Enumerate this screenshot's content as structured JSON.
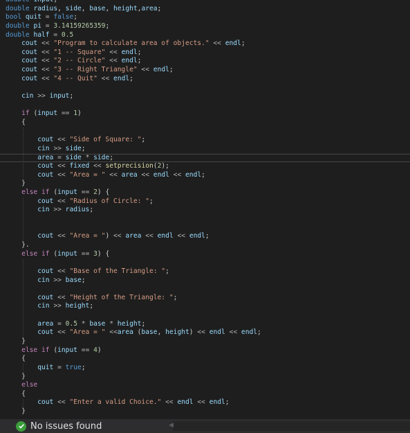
{
  "editor": {
    "lines": [
      [
        [
          "kw",
          "double"
        ],
        [
          "plain",
          " "
        ],
        [
          "id",
          "input"
        ],
        [
          "plain",
          ";"
        ]
      ],
      [
        [
          "kw",
          "double"
        ],
        [
          "plain",
          " "
        ],
        [
          "id",
          "radius"
        ],
        [
          "plain",
          ", "
        ],
        [
          "id",
          "side"
        ],
        [
          "plain",
          ", "
        ],
        [
          "id",
          "base"
        ],
        [
          "plain",
          ", "
        ],
        [
          "id",
          "height"
        ],
        [
          "plain",
          ","
        ],
        [
          "id",
          "area"
        ],
        [
          "plain",
          ";"
        ]
      ],
      [
        [
          "kw",
          "bool"
        ],
        [
          "plain",
          " "
        ],
        [
          "id",
          "quit"
        ],
        [
          "plain",
          " "
        ],
        [
          "op",
          "="
        ],
        [
          "plain",
          " "
        ],
        [
          "kw",
          "false"
        ],
        [
          "plain",
          ";"
        ]
      ],
      [
        [
          "kw",
          "double"
        ],
        [
          "plain",
          " "
        ],
        [
          "id",
          "pi"
        ],
        [
          "plain",
          " "
        ],
        [
          "op",
          "="
        ],
        [
          "plain",
          " "
        ],
        [
          "num",
          "3.14159265359"
        ],
        [
          "plain",
          ";"
        ]
      ],
      [
        [
          "kw",
          "double"
        ],
        [
          "plain",
          " "
        ],
        [
          "id",
          "half"
        ],
        [
          "plain",
          " "
        ],
        [
          "op",
          "="
        ],
        [
          "plain",
          " "
        ],
        [
          "num",
          "0.5"
        ]
      ],
      [
        [
          "plain",
          "    "
        ],
        [
          "id",
          "cout"
        ],
        [
          "plain",
          " "
        ],
        [
          "op",
          "<<"
        ],
        [
          "plain",
          " "
        ],
        [
          "str",
          "\"Program to calculate area of objects.\""
        ],
        [
          "plain",
          " "
        ],
        [
          "op",
          "<<"
        ],
        [
          "plain",
          " "
        ],
        [
          "id",
          "endl"
        ],
        [
          "plain",
          ";"
        ]
      ],
      [
        [
          "plain",
          "    "
        ],
        [
          "id",
          "cout"
        ],
        [
          "plain",
          " "
        ],
        [
          "op",
          "<<"
        ],
        [
          "plain",
          " "
        ],
        [
          "str",
          "\"1 -- Square\""
        ],
        [
          "plain",
          " "
        ],
        [
          "op",
          "<<"
        ],
        [
          "plain",
          " "
        ],
        [
          "id",
          "endl"
        ],
        [
          "plain",
          ";"
        ]
      ],
      [
        [
          "plain",
          "    "
        ],
        [
          "id",
          "cout"
        ],
        [
          "plain",
          " "
        ],
        [
          "op",
          "<<"
        ],
        [
          "plain",
          " "
        ],
        [
          "str",
          "\"2 -- Circle\""
        ],
        [
          "plain",
          " "
        ],
        [
          "op",
          "<<"
        ],
        [
          "plain",
          " "
        ],
        [
          "id",
          "endl"
        ],
        [
          "plain",
          ";"
        ]
      ],
      [
        [
          "plain",
          "    "
        ],
        [
          "id",
          "cout"
        ],
        [
          "plain",
          " "
        ],
        [
          "op",
          "<<"
        ],
        [
          "plain",
          " "
        ],
        [
          "str",
          "\"3 -- Right Triangle\""
        ],
        [
          "plain",
          " "
        ],
        [
          "op",
          "<<"
        ],
        [
          "plain",
          " "
        ],
        [
          "id",
          "endl"
        ],
        [
          "plain",
          ";"
        ]
      ],
      [
        [
          "plain",
          "    "
        ],
        [
          "id",
          "cout"
        ],
        [
          "plain",
          " "
        ],
        [
          "op",
          "<<"
        ],
        [
          "plain",
          " "
        ],
        [
          "str",
          "\"4 -- Quit\""
        ],
        [
          "plain",
          " "
        ],
        [
          "op",
          "<<"
        ],
        [
          "plain",
          " "
        ],
        [
          "id",
          "endl"
        ],
        [
          "plain",
          ";"
        ]
      ],
      [],
      [
        [
          "plain",
          "    "
        ],
        [
          "id",
          "cin"
        ],
        [
          "plain",
          " "
        ],
        [
          "op",
          ">>"
        ],
        [
          "plain",
          " "
        ],
        [
          "id",
          "input"
        ],
        [
          "plain",
          ";"
        ]
      ],
      [],
      [
        [
          "plain",
          "    "
        ],
        [
          "ctl",
          "if"
        ],
        [
          "plain",
          " ("
        ],
        [
          "id",
          "input"
        ],
        [
          "plain",
          " "
        ],
        [
          "op",
          "=="
        ],
        [
          "plain",
          " "
        ],
        [
          "num",
          "1"
        ],
        [
          "plain",
          ")"
        ]
      ],
      [
        [
          "plain",
          "    {"
        ]
      ],
      [],
      [
        [
          "plain",
          "        "
        ],
        [
          "id",
          "cout"
        ],
        [
          "plain",
          " "
        ],
        [
          "op",
          "<<"
        ],
        [
          "plain",
          " "
        ],
        [
          "str",
          "\"Side of Square: \""
        ],
        [
          "plain",
          ";"
        ]
      ],
      [
        [
          "plain",
          "        "
        ],
        [
          "id",
          "cin"
        ],
        [
          "plain",
          " "
        ],
        [
          "op",
          ">>"
        ],
        [
          "plain",
          " "
        ],
        [
          "id",
          "side"
        ],
        [
          "plain",
          ";"
        ]
      ],
      [
        [
          "plain",
          "        "
        ],
        [
          "id",
          "area"
        ],
        [
          "plain",
          " "
        ],
        [
          "op",
          "="
        ],
        [
          "plain",
          " "
        ],
        [
          "id",
          "side"
        ],
        [
          "plain",
          " "
        ],
        [
          "op",
          "*"
        ],
        [
          "plain",
          " "
        ],
        [
          "id",
          "side"
        ],
        [
          "plain",
          ";"
        ]
      ],
      [
        [
          "plain",
          "        "
        ],
        [
          "id",
          "cout"
        ],
        [
          "plain",
          " "
        ],
        [
          "op",
          "<<"
        ],
        [
          "plain",
          " "
        ],
        [
          "id",
          "fixed"
        ],
        [
          "plain",
          " "
        ],
        [
          "op",
          "<<"
        ],
        [
          "plain",
          " "
        ],
        [
          "fn",
          "setprecision"
        ],
        [
          "plain",
          "("
        ],
        [
          "num",
          "2"
        ],
        [
          "plain",
          ");"
        ]
      ],
      [
        [
          "plain",
          "        "
        ],
        [
          "id",
          "cout"
        ],
        [
          "plain",
          " "
        ],
        [
          "op",
          "<<"
        ],
        [
          "plain",
          " "
        ],
        [
          "str",
          "\"Area = \""
        ],
        [
          "plain",
          " "
        ],
        [
          "op",
          "<<"
        ],
        [
          "plain",
          " "
        ],
        [
          "id",
          "area"
        ],
        [
          "plain",
          " "
        ],
        [
          "op",
          "<<"
        ],
        [
          "plain",
          " "
        ],
        [
          "id",
          "endl"
        ],
        [
          "plain",
          " "
        ],
        [
          "op",
          "<<"
        ],
        [
          "plain",
          " "
        ],
        [
          "id",
          "endl"
        ],
        [
          "plain",
          ";"
        ]
      ],
      [
        [
          "plain",
          "    }"
        ]
      ],
      [
        [
          "plain",
          "    "
        ],
        [
          "ctl",
          "else"
        ],
        [
          "plain",
          " "
        ],
        [
          "ctl",
          "if"
        ],
        [
          "plain",
          " ("
        ],
        [
          "id",
          "input"
        ],
        [
          "plain",
          " "
        ],
        [
          "op",
          "=="
        ],
        [
          "plain",
          " "
        ],
        [
          "num",
          "2"
        ],
        [
          "plain",
          ") {"
        ]
      ],
      [
        [
          "plain",
          "        "
        ],
        [
          "id",
          "cout"
        ],
        [
          "plain",
          " "
        ],
        [
          "op",
          "<<"
        ],
        [
          "plain",
          " "
        ],
        [
          "str",
          "\"Radius of Circle: \""
        ],
        [
          "plain",
          ";"
        ]
      ],
      [
        [
          "plain",
          "        "
        ],
        [
          "id",
          "cin"
        ],
        [
          "plain",
          " "
        ],
        [
          "op",
          ">>"
        ],
        [
          "plain",
          " "
        ],
        [
          "id",
          "radius"
        ],
        [
          "plain",
          ";"
        ]
      ],
      [],
      [],
      [
        [
          "plain",
          "        "
        ],
        [
          "id",
          "cout"
        ],
        [
          "plain",
          " "
        ],
        [
          "op",
          "<<"
        ],
        [
          "plain",
          " "
        ],
        [
          "str",
          "\"Area = \""
        ],
        [
          "plain",
          ") "
        ],
        [
          "op",
          "<<"
        ],
        [
          "plain",
          " "
        ],
        [
          "id",
          "area"
        ],
        [
          "plain",
          " "
        ],
        [
          "op",
          "<<"
        ],
        [
          "plain",
          " "
        ],
        [
          "id",
          "endl"
        ],
        [
          "plain",
          " "
        ],
        [
          "op",
          "<<"
        ],
        [
          "plain",
          " "
        ],
        [
          "id",
          "endl"
        ],
        [
          "plain",
          ";"
        ]
      ],
      [
        [
          "plain",
          "    }."
        ]
      ],
      [
        [
          "plain",
          "    "
        ],
        [
          "ctl",
          "else"
        ],
        [
          "plain",
          " "
        ],
        [
          "ctl",
          "if"
        ],
        [
          "plain",
          " ("
        ],
        [
          "id",
          "input"
        ],
        [
          "plain",
          " "
        ],
        [
          "op",
          "=="
        ],
        [
          "plain",
          " "
        ],
        [
          "num",
          "3"
        ],
        [
          "plain",
          ") {"
        ]
      ],
      [],
      [
        [
          "plain",
          "        "
        ],
        [
          "id",
          "cout"
        ],
        [
          "plain",
          " "
        ],
        [
          "op",
          "<<"
        ],
        [
          "plain",
          " "
        ],
        [
          "str",
          "\"Base of the Triangle: \""
        ],
        [
          "plain",
          ";"
        ]
      ],
      [
        [
          "plain",
          "        "
        ],
        [
          "id",
          "cin"
        ],
        [
          "plain",
          " "
        ],
        [
          "op",
          ">>"
        ],
        [
          "plain",
          " "
        ],
        [
          "id",
          "base"
        ],
        [
          "plain",
          ";"
        ]
      ],
      [],
      [
        [
          "plain",
          "        "
        ],
        [
          "id",
          "cout"
        ],
        [
          "plain",
          " "
        ],
        [
          "op",
          "<<"
        ],
        [
          "plain",
          " "
        ],
        [
          "str",
          "\"Height of the Triangle: \""
        ],
        [
          "plain",
          ";"
        ]
      ],
      [
        [
          "plain",
          "        "
        ],
        [
          "id",
          "cin"
        ],
        [
          "plain",
          " "
        ],
        [
          "op",
          ">>"
        ],
        [
          "plain",
          " "
        ],
        [
          "id",
          "height"
        ],
        [
          "plain",
          ";"
        ]
      ],
      [],
      [
        [
          "plain",
          "        "
        ],
        [
          "id",
          "area"
        ],
        [
          "plain",
          " "
        ],
        [
          "op",
          "="
        ],
        [
          "plain",
          " "
        ],
        [
          "num",
          "0.5"
        ],
        [
          "plain",
          " "
        ],
        [
          "op",
          "*"
        ],
        [
          "plain",
          " "
        ],
        [
          "id",
          "base"
        ],
        [
          "plain",
          " "
        ],
        [
          "op",
          "*"
        ],
        [
          "plain",
          " "
        ],
        [
          "id",
          "height"
        ],
        [
          "plain",
          ";"
        ]
      ],
      [
        [
          "plain",
          "        "
        ],
        [
          "id",
          "cout"
        ],
        [
          "plain",
          " "
        ],
        [
          "op",
          "<<"
        ],
        [
          "plain",
          " "
        ],
        [
          "str",
          "\"Area = \""
        ],
        [
          "plain",
          " "
        ],
        [
          "op",
          "<<"
        ],
        [
          "id",
          "area"
        ],
        [
          "plain",
          " ("
        ],
        [
          "id",
          "base"
        ],
        [
          "plain",
          ", "
        ],
        [
          "id",
          "height"
        ],
        [
          "plain",
          ") "
        ],
        [
          "op",
          "<<"
        ],
        [
          "plain",
          " "
        ],
        [
          "id",
          "endl"
        ],
        [
          "plain",
          " "
        ],
        [
          "op",
          "<<"
        ],
        [
          "plain",
          " "
        ],
        [
          "id",
          "endl"
        ],
        [
          "plain",
          ";"
        ]
      ],
      [
        [
          "plain",
          "    }"
        ]
      ],
      [
        [
          "plain",
          "    "
        ],
        [
          "ctl",
          "else"
        ],
        [
          "plain",
          " "
        ],
        [
          "ctl",
          "if"
        ],
        [
          "plain",
          " ("
        ],
        [
          "id",
          "input"
        ],
        [
          "plain",
          " "
        ],
        [
          "op",
          "=="
        ],
        [
          "plain",
          " "
        ],
        [
          "num",
          "4"
        ],
        [
          "plain",
          ")"
        ]
      ],
      [
        [
          "plain",
          "    {"
        ]
      ],
      [
        [
          "plain",
          "        "
        ],
        [
          "id",
          "quit"
        ],
        [
          "plain",
          " "
        ],
        [
          "op",
          "="
        ],
        [
          "plain",
          " "
        ],
        [
          "kw",
          "true"
        ],
        [
          "plain",
          ";"
        ]
      ],
      [
        [
          "plain",
          "    }"
        ]
      ],
      [
        [
          "plain",
          "    "
        ],
        [
          "ctl",
          "else"
        ]
      ],
      [
        [
          "plain",
          "    {"
        ]
      ],
      [
        [
          "plain",
          "        "
        ],
        [
          "id",
          "cout"
        ],
        [
          "plain",
          " "
        ],
        [
          "op",
          "<<"
        ],
        [
          "plain",
          " "
        ],
        [
          "str",
          "\"Enter a valid Choice.\""
        ],
        [
          "plain",
          " "
        ],
        [
          "op",
          "<<"
        ],
        [
          "plain",
          " "
        ],
        [
          "id",
          "endl"
        ],
        [
          "plain",
          " "
        ],
        [
          "op",
          "<<"
        ],
        [
          "plain",
          " "
        ],
        [
          "id",
          "endl"
        ],
        [
          "plain",
          ";"
        ]
      ],
      [
        [
          "plain",
          "    }"
        ]
      ]
    ],
    "current_line": 18
  },
  "status": {
    "text": "No issues found",
    "icon": "check-circle-icon",
    "arrow_icon": "scroll-left-icon",
    "ok_color": "#3a9e3a"
  }
}
